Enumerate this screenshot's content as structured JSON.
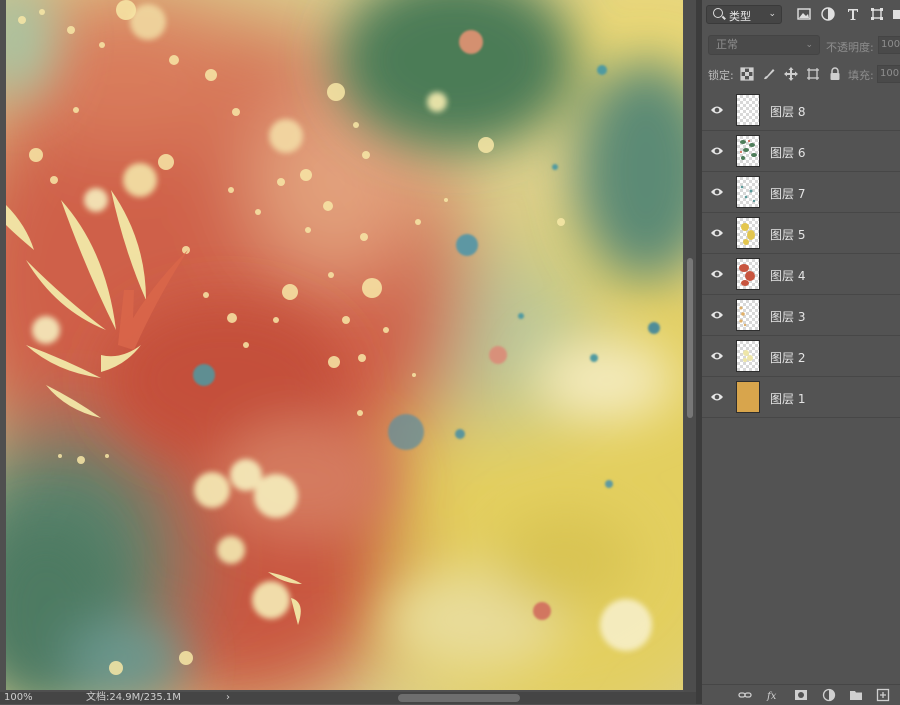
{
  "status_bar": {
    "zoom": "100%",
    "document_size": "文档:24.9M/235.1M",
    "arrow": "›"
  },
  "layers_panel": {
    "filter": {
      "label": "类型",
      "chevron": "⌄",
      "icons": [
        "image-filter-icon",
        "adjustment-filter-icon",
        "type-filter-icon",
        "shape-filter-icon",
        "smart-object-filter-icon"
      ]
    },
    "blend_mode": {
      "value": "正常",
      "chevron": "⌄"
    },
    "opacity": {
      "label": "不透明度:",
      "value": "100"
    },
    "lock": {
      "label": "锁定:",
      "icons": [
        "lock-transparency-icon",
        "lock-pixels-icon",
        "lock-position-icon",
        "lock-artboard-icon",
        "lock-all-icon"
      ]
    },
    "fill": {
      "label": "填充:",
      "value": "100"
    },
    "layers": [
      {
        "name": "图层 8",
        "visible": true,
        "thumbnail": "transparent"
      },
      {
        "name": "图层 6",
        "visible": true,
        "thumbnail": "green-leaves"
      },
      {
        "name": "图层 7",
        "visible": true,
        "thumbnail": "teal-dots"
      },
      {
        "name": "图层 5",
        "visible": true,
        "thumbnail": "yellow-blobs"
      },
      {
        "name": "图层 4",
        "visible": true,
        "thumbnail": "red-blobs"
      },
      {
        "name": "图层 3",
        "visible": true,
        "thumbnail": "orange-dots"
      },
      {
        "name": "图层 2",
        "visible": true,
        "thumbnail": "pale-spots"
      },
      {
        "name": "图层 1",
        "visible": true,
        "thumbnail": "paper-texture"
      }
    ],
    "bottom_toolbar": [
      "link-layers-icon",
      "fx-icon",
      "add-mask-icon",
      "new-adjustment-icon",
      "new-group-icon",
      "new-layer-icon"
    ]
  },
  "colors": {
    "panel_background": "#535353",
    "watercolor_red": "#c8553f",
    "watercolor_green": "#4e7d5a",
    "watercolor_yellow": "#e3cf62",
    "watercolor_cream": "#f2e9b0",
    "watercolor_teal": "#5b8a8a"
  }
}
